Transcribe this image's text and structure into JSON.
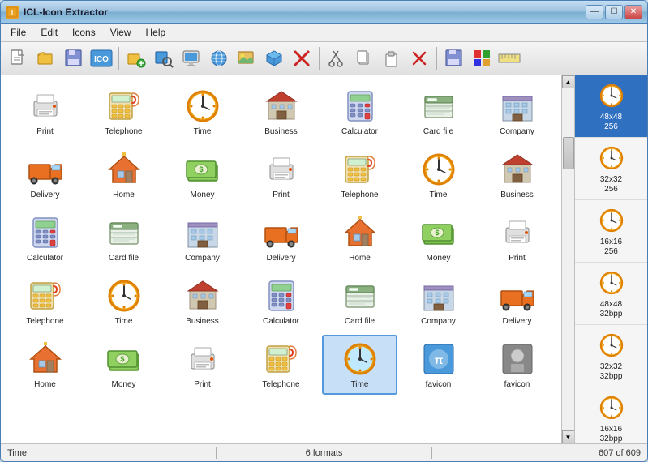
{
  "window": {
    "title": "ICL-Icon Extractor",
    "title_icon": "🖼"
  },
  "titleButtons": [
    "—",
    "☐",
    "✕"
  ],
  "menuBar": {
    "items": [
      "File",
      "Edit",
      "Icons",
      "View",
      "Help"
    ]
  },
  "toolbar": {
    "buttons": [
      {
        "name": "new",
        "icon": "📄"
      },
      {
        "name": "open",
        "icon": "📂"
      },
      {
        "name": "save",
        "icon": "💾"
      },
      {
        "name": "ico",
        "icon": "🏷"
      },
      {
        "name": "sep1"
      },
      {
        "name": "add",
        "icon": "➕"
      },
      {
        "name": "find",
        "icon": "🔍"
      },
      {
        "name": "monitor",
        "icon": "🖥"
      },
      {
        "name": "globe",
        "icon": "🌐"
      },
      {
        "name": "image",
        "icon": "🖼"
      },
      {
        "name": "box",
        "icon": "📦"
      },
      {
        "name": "delete",
        "icon": "❌"
      },
      {
        "name": "sep2"
      },
      {
        "name": "cut",
        "icon": "✂"
      },
      {
        "name": "copy",
        "icon": "📋"
      },
      {
        "name": "paste",
        "icon": "📌"
      },
      {
        "name": "delete2",
        "icon": "🗑"
      },
      {
        "name": "sep3"
      },
      {
        "name": "save2",
        "icon": "💾"
      },
      {
        "name": "windows",
        "icon": "🪟"
      },
      {
        "name": "ruler",
        "icon": "📏"
      }
    ]
  },
  "icons": [
    {
      "label": "Print",
      "type": "print",
      "row": 0
    },
    {
      "label": "Telephone",
      "type": "telephone",
      "row": 0
    },
    {
      "label": "Time",
      "type": "clock",
      "row": 0
    },
    {
      "label": "Business",
      "type": "building",
      "row": 0
    },
    {
      "label": "Calculator",
      "type": "calculator",
      "row": 0
    },
    {
      "label": "Card file",
      "type": "cardfile",
      "row": 0
    },
    {
      "label": "Company",
      "type": "company",
      "row": 0
    },
    {
      "label": "Delivery",
      "type": "truck",
      "row": 1
    },
    {
      "label": "Home",
      "type": "home",
      "row": 1
    },
    {
      "label": "Money",
      "type": "money",
      "row": 1
    },
    {
      "label": "Print",
      "type": "print",
      "row": 1
    },
    {
      "label": "Telephone",
      "type": "telephone",
      "row": 1
    },
    {
      "label": "Time",
      "type": "clock",
      "row": 1
    },
    {
      "label": "Business",
      "type": "building",
      "row": 1
    },
    {
      "label": "Calculator",
      "type": "calculator",
      "row": 2
    },
    {
      "label": "Card file",
      "type": "cardfile",
      "row": 2
    },
    {
      "label": "Company",
      "type": "company",
      "row": 2
    },
    {
      "label": "Delivery",
      "type": "truck",
      "row": 2
    },
    {
      "label": "Home",
      "type": "home",
      "row": 2
    },
    {
      "label": "Money",
      "type": "money",
      "row": 2
    },
    {
      "label": "Print",
      "type": "print",
      "row": 2
    },
    {
      "label": "Telephone",
      "type": "telephone",
      "row": 3
    },
    {
      "label": "Time",
      "type": "clock",
      "row": 3
    },
    {
      "label": "Business",
      "type": "building",
      "row": 3
    },
    {
      "label": "Calculator",
      "type": "calculator",
      "row": 3
    },
    {
      "label": "Card file",
      "type": "cardfile",
      "row": 3
    },
    {
      "label": "Company",
      "type": "company",
      "row": 3
    },
    {
      "label": "Delivery",
      "type": "truck",
      "row": 3
    },
    {
      "label": "Home",
      "type": "home",
      "row": 4
    },
    {
      "label": "Money",
      "type": "money",
      "row": 4
    },
    {
      "label": "Print",
      "type": "print",
      "row": 4
    },
    {
      "label": "Telephone",
      "type": "telephone",
      "row": 4
    },
    {
      "label": "Time",
      "type": "clock_blue",
      "row": 4,
      "selected": true
    },
    {
      "label": "favicon",
      "type": "favicon1",
      "row": 4
    },
    {
      "label": "favicon",
      "type": "favicon2",
      "row": 4
    }
  ],
  "sidebar": {
    "items": [
      {
        "label": "48x48\n256",
        "selected": true
      },
      {
        "label": "32x32\n256",
        "selected": false
      },
      {
        "label": "16x16\n256",
        "selected": false
      },
      {
        "label": "48x48\n32bpp",
        "selected": false
      },
      {
        "label": "32x32\n32bpp",
        "selected": false
      },
      {
        "label": "16x16\n32bpp",
        "selected": false
      }
    ]
  },
  "statusBar": {
    "left": "Time",
    "center": "6 formats",
    "right": "607 of 609"
  }
}
